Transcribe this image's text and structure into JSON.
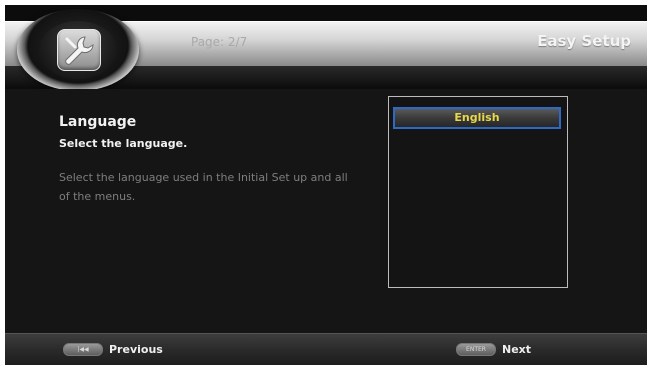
{
  "header": {
    "page_indicator": "Page: 2/7",
    "title": "Easy Setup",
    "logo_icon": "wrench-tool-icon"
  },
  "content": {
    "heading": "Language",
    "subheading": "Select the language.",
    "description": "Select the language used in the Initial Set up and all of the menus."
  },
  "language_list": {
    "selected": "English",
    "items": [
      "English"
    ]
  },
  "footer": {
    "previous_key": "|◀◀",
    "previous_label": "Previous",
    "next_key": "ENTER",
    "next_label": "Next"
  },
  "colors": {
    "selection_border": "#2e69c6",
    "selection_text": "#e8d84a"
  }
}
